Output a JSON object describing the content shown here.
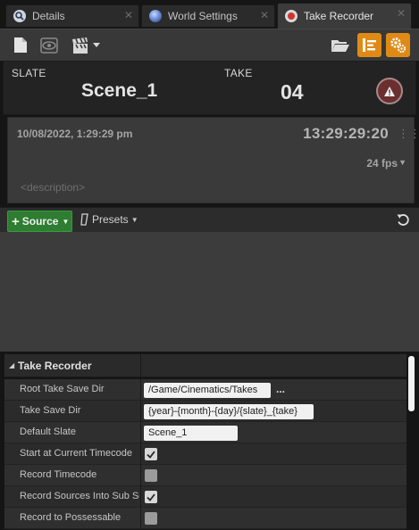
{
  "tabs": [
    {
      "label": "Details",
      "icon": "details-icon",
      "close": "✕"
    },
    {
      "label": "World Settings",
      "icon": "globe-icon",
      "close": "✕"
    },
    {
      "label": "Take Recorder",
      "icon": "record-icon",
      "close": "✕"
    }
  ],
  "toolbar": {
    "new_icon": "document-icon",
    "review_icon": "eye-icon",
    "clapper_icon": "clapperboard-icon",
    "open_icon": "folder-open-icon",
    "sequence_icon": "sequencer-icon",
    "settings_icon": "gear-icon",
    "accent": "#e08a16"
  },
  "slate": {
    "slate_caption": "SLATE",
    "slate_value": "Scene_1",
    "take_caption": "TAKE",
    "take_value": "04",
    "status": "warning"
  },
  "info": {
    "datetime": "10/08/2022, 1:29:29 pm",
    "timecode": "13:29:29:20",
    "framerate": "24 fps",
    "description_placeholder": "<description>"
  },
  "sources": {
    "add_label": "Source",
    "presets_label": "Presets",
    "add_color": "#2e7d32"
  },
  "details": {
    "category": "Take Recorder",
    "rows": [
      {
        "name": "Root Take Save Dir",
        "type": "text",
        "value": "/Game/Cinematics/Takes",
        "browse": "..."
      },
      {
        "name": "Take Save Dir",
        "type": "text",
        "value": "{year}-{month}-{day}/{slate}_{take}"
      },
      {
        "name": "Default Slate",
        "type": "text",
        "value": "Scene_1"
      },
      {
        "name": "Start at Current Timecode",
        "type": "check",
        "checked": true
      },
      {
        "name": "Record Timecode",
        "type": "check",
        "checked": false
      },
      {
        "name": "Record Sources Into Sub Sequences",
        "type": "check",
        "checked": true
      },
      {
        "name": "Record to Possessable",
        "type": "check",
        "checked": false
      }
    ]
  }
}
